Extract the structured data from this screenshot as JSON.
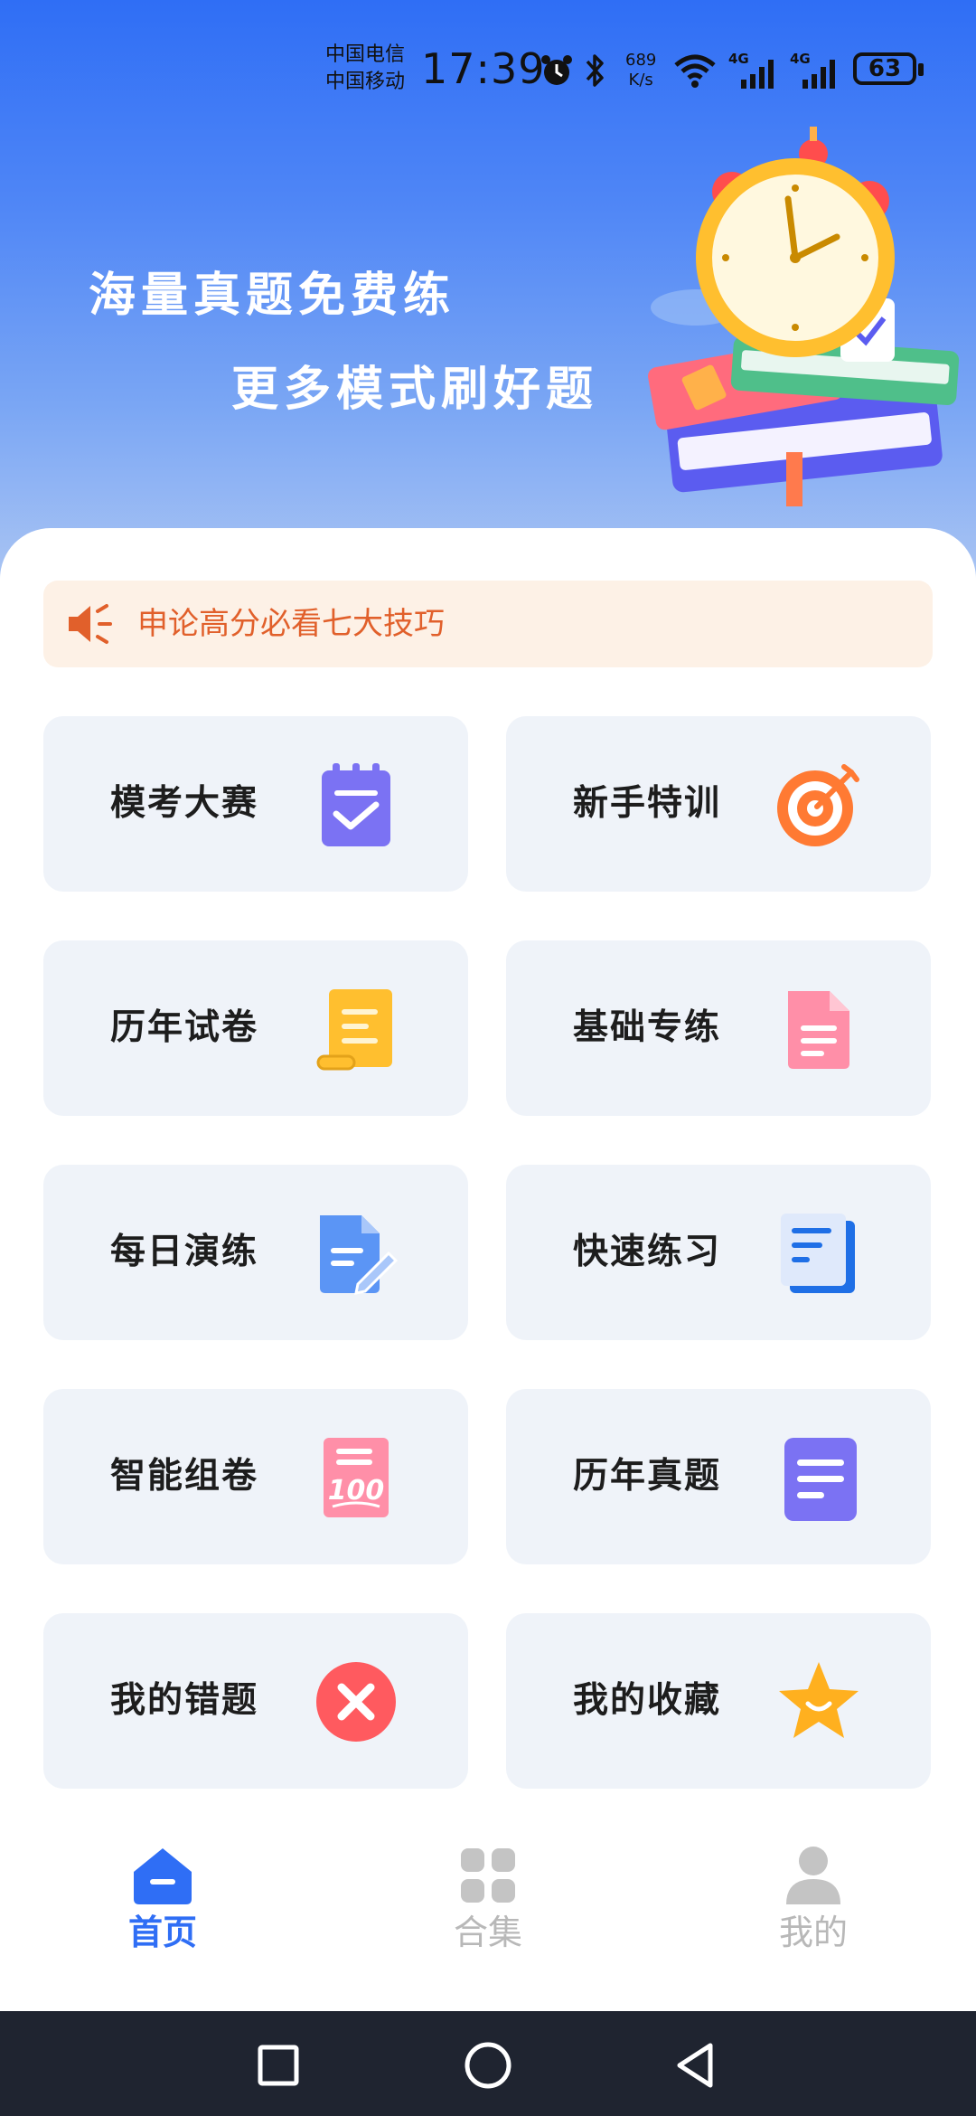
{
  "status_bar": {
    "carrier_1": "中国电信",
    "carrier_2": "中国移动",
    "time": "17:39",
    "speed_value": "689",
    "speed_unit": "K/s",
    "network_1": "4G",
    "network_2": "4G",
    "battery": "63"
  },
  "hero": {
    "line1": "海量真题免费练",
    "line2": "更多模式刷好题"
  },
  "notice": {
    "text": "申论高分必看七大技巧",
    "color": "#e1602b"
  },
  "cards": [
    {
      "label": "模考大赛",
      "icon": "clipboard-check-icon"
    },
    {
      "label": "新手特训",
      "icon": "target-icon"
    },
    {
      "label": "历年试卷",
      "icon": "scroll-icon"
    },
    {
      "label": "基础专练",
      "icon": "document-icon"
    },
    {
      "label": "每日演练",
      "icon": "edit-document-icon"
    },
    {
      "label": "快速练习",
      "icon": "notes-icon"
    },
    {
      "label": "智能组卷",
      "icon": "score-100-icon"
    },
    {
      "label": "历年真题",
      "icon": "text-document-icon"
    },
    {
      "label": "我的错题",
      "icon": "close-circle-icon"
    },
    {
      "label": "我的收藏",
      "icon": "star-icon"
    }
  ],
  "tabbar": {
    "items": [
      {
        "label": "首页",
        "icon": "home-icon",
        "active": true
      },
      {
        "label": "合集",
        "icon": "grid-icon",
        "active": false
      },
      {
        "label": "我的",
        "icon": "user-icon",
        "active": false
      }
    ],
    "active_color": "#2f6ef5",
    "inactive_color": "#b8b8b8"
  },
  "navbar": {
    "buttons": [
      "recent-apps-icon",
      "home-circle-icon",
      "back-icon"
    ]
  }
}
